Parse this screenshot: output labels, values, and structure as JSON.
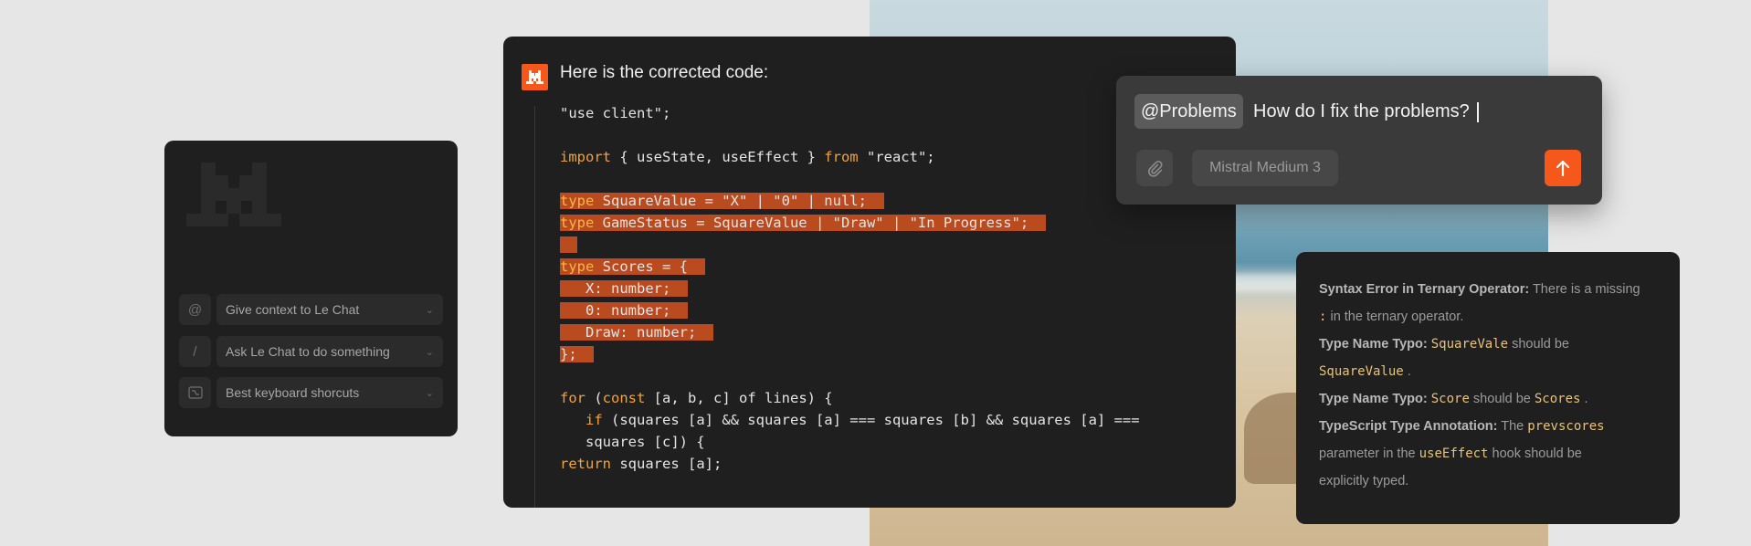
{
  "left_panel": {
    "commands": [
      {
        "icon": "at-icon",
        "glyph": "@",
        "label": "Give context to Le Chat"
      },
      {
        "icon": "slash-icon",
        "glyph": "/",
        "label": "Ask Le Chat to do something"
      },
      {
        "icon": "keyboard-icon",
        "glyph": "⌥",
        "label": "Best keyboard shorcuts"
      }
    ]
  },
  "code_panel": {
    "title": "Here is the corrected code:",
    "lines": [
      "\"use client\";",
      "",
      "import { useState, useEffect } from \"react\";",
      "",
      "type SquareValue = \"X\" | \"0\" | null;",
      "type GameStatus = SquareValue | \"Draw\" | \"In Progress\";",
      "",
      "type Scores = {",
      "   X: number;",
      "   0: number;",
      "   Draw: number;",
      "};",
      "",
      "for (const [a, b, c] of lines) {",
      "   if (squares [a] && squares [a] === squares [b] && squares [a] ===",
      "   squares [c]) {",
      "return squares [a];"
    ]
  },
  "prompt": {
    "mention": "@Problems",
    "text": "How do I fix the problems?",
    "model": "Mistral Medium 3"
  },
  "problems": {
    "p1_title": "Syntax Error in Ternary Operator:",
    "p1_a": " There is a missing",
    "p1_code": ":",
    "p1_b": " in the ternary operator.",
    "p2_title": "Type Name Typo:",
    "p2_code1": "SquareVale",
    "p2_mid": " should be",
    "p2_code2": "SquareValue",
    "p2_end": " .",
    "p3_title": "Type Name Typo:",
    "p3_code1": "Score",
    "p3_mid": " should be ",
    "p3_code2": "Scores",
    "p3_end": " .",
    "p4_title": "TypeScript Type Annotation:",
    "p4_a": " The ",
    "p4_code1": "prevscores",
    "p4_b": "parameter in the ",
    "p4_code2": "useEffect",
    "p4_c": "  hook should be",
    "p4_d": "explicitly typed."
  },
  "colors": {
    "accent": "#f5581a",
    "highlight": "#b94b1f",
    "keyword": "#f2a33a"
  }
}
